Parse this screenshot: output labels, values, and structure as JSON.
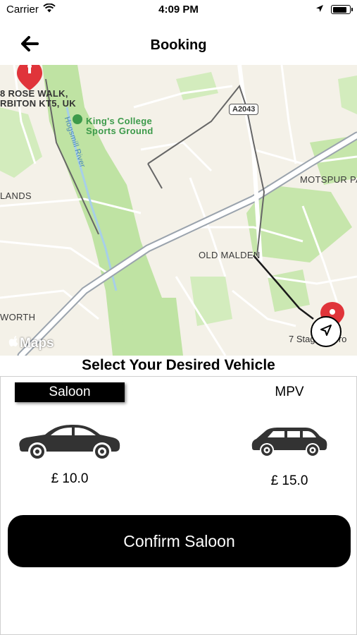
{
  "status_bar": {
    "carrier": "Carrier",
    "time": "4:09 PM",
    "battery_level": 0.9,
    "icons": [
      "wifi-icon",
      "location-arrow-icon",
      "battery-icon"
    ]
  },
  "nav": {
    "title": "Booking",
    "back_icon": "arrow-left-icon"
  },
  "map": {
    "labels": {
      "origin_address_line1": "8 ROSE WALK,",
      "origin_address_line2": "RBITON KT5, UK",
      "park_line1": "King's College",
      "park_line2": "Sports Ground",
      "river": "Hogsmill River",
      "road": "A2043",
      "area_left": "LANDS",
      "area_right": "MOTSPUR PA",
      "old_malden": "OLD MALDEN",
      "area_bottom_left": "WORTH",
      "destination": "7 Stagg Appro"
    },
    "brand": "Maps",
    "colors": {
      "background": "#f4f1e8",
      "park": "#bfe3a3",
      "road": "#ffffff",
      "route": "#1a1a1a",
      "pin": "#e0343a"
    }
  },
  "selection": {
    "heading": "Select Your Desired Vehicle",
    "vehicles": [
      {
        "name": "Saloon",
        "price": "£ 10.0",
        "selected": true,
        "icon": "saloon-car-icon"
      },
      {
        "name": "MPV",
        "price": "£ 15.0",
        "selected": false,
        "icon": "mpv-car-icon"
      }
    ],
    "confirm_label": "Confirm Saloon"
  }
}
